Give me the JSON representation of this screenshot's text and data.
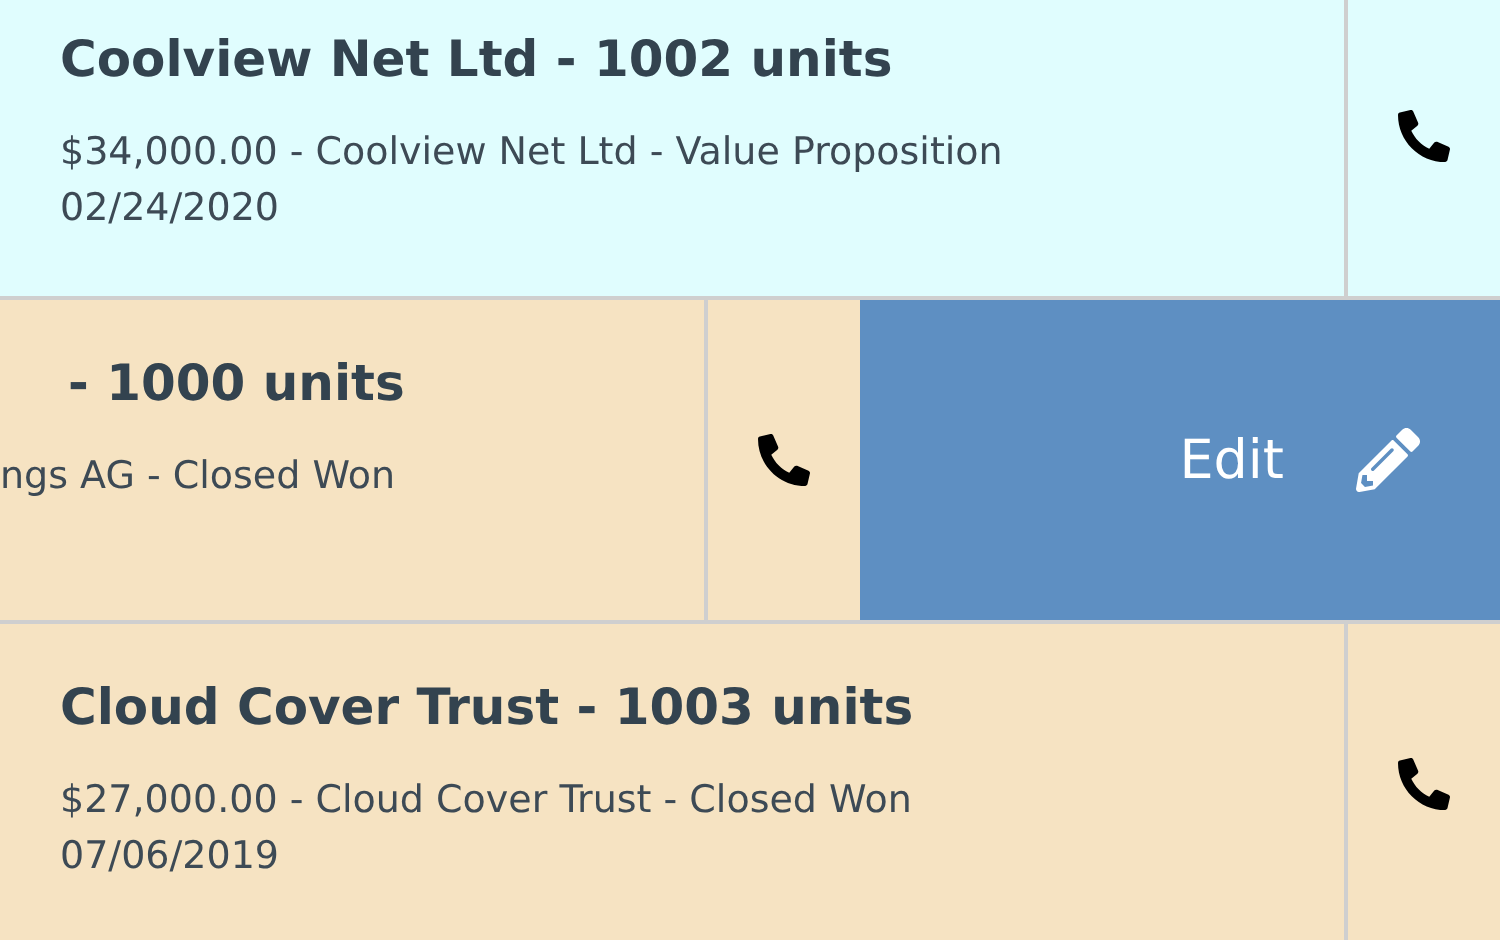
{
  "rows": [
    {
      "title": "Coolview Net Ltd - 1002 units",
      "subtitle": "$34,000.00 - Coolview Net Ltd - Value Proposition",
      "date": "02/24/2020",
      "color": "#e0fdfe",
      "swiped": false
    },
    {
      "title": "- 1000 units",
      "subtitle": "ngs AG - Closed Won",
      "color": "#f6e3c2",
      "swiped": true,
      "action": "Edit"
    },
    {
      "title": "Cloud Cover Trust - 1003 units",
      "subtitle": "$27,000.00 - Cloud Cover Trust - Closed Won",
      "date": "07/06/2019",
      "color": "#f6e3c2",
      "swiped": false
    }
  ]
}
